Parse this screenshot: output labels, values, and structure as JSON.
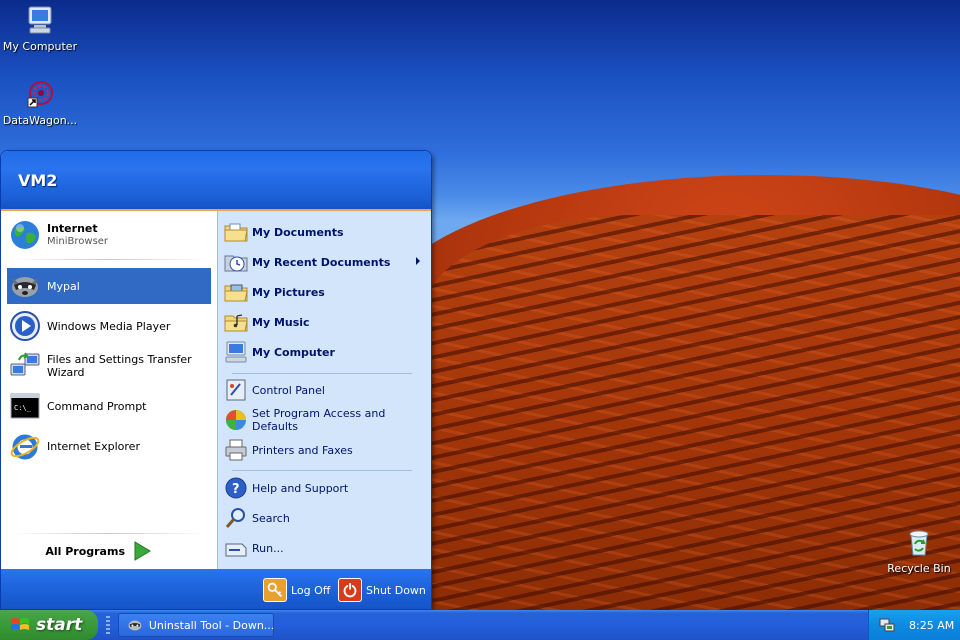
{
  "desktop": {
    "icons": [
      {
        "label": "My Computer",
        "icon": "computer-icon"
      },
      {
        "label": "DataWagon...",
        "icon": "datawagon-shortcut-icon"
      },
      {
        "label": "Recycle Bin",
        "icon": "recycle-bin-icon"
      }
    ]
  },
  "start_menu": {
    "user": "VM2",
    "pinned": [
      {
        "title": "Internet",
        "subtitle": "MiniBrowser",
        "icon": "globe-icon"
      }
    ],
    "recent": [
      {
        "label": "Mypal",
        "icon": "raccoon-icon",
        "selected": true
      },
      {
        "label": "Windows Media Player",
        "icon": "media-player-icon"
      },
      {
        "label": "Files and Settings Transfer Wizard",
        "icon": "transfer-wizard-icon"
      },
      {
        "label": "Command Prompt",
        "icon": "command-prompt-icon"
      },
      {
        "label": "Internet Explorer",
        "icon": "internet-explorer-icon"
      }
    ],
    "all_programs": "All Programs",
    "places": [
      {
        "label": "My Documents",
        "icon": "folder-icon"
      },
      {
        "label": "My Recent Documents",
        "icon": "recent-documents-icon",
        "submenu": true
      },
      {
        "label": "My Pictures",
        "icon": "folder-pictures-icon"
      },
      {
        "label": "My Music",
        "icon": "folder-music-icon"
      },
      {
        "label": "My Computer",
        "icon": "computer-icon"
      }
    ],
    "system": [
      {
        "label": "Control Panel",
        "icon": "control-panel-icon"
      },
      {
        "label": "Set Program Access and Defaults",
        "icon": "program-defaults-icon"
      },
      {
        "label": "Printers and Faxes",
        "icon": "printer-icon"
      }
    ],
    "help": [
      {
        "label": "Help and Support",
        "icon": "help-icon"
      },
      {
        "label": "Search",
        "icon": "search-icon"
      },
      {
        "label": "Run...",
        "icon": "run-icon"
      }
    ],
    "log_off": "Log Off",
    "shut_down": "Shut Down"
  },
  "taskbar": {
    "start_label": "start",
    "tasks": [
      {
        "label": "Uninstall Tool - Down...",
        "icon": "raccoon-icon"
      }
    ],
    "clock": "8:25 AM"
  },
  "colors": {
    "start_menu_blue": "#1f6ce8",
    "selection": "#316ac5",
    "start_green": "#3c9c3b",
    "tray_blue": "#0e8ae0"
  }
}
